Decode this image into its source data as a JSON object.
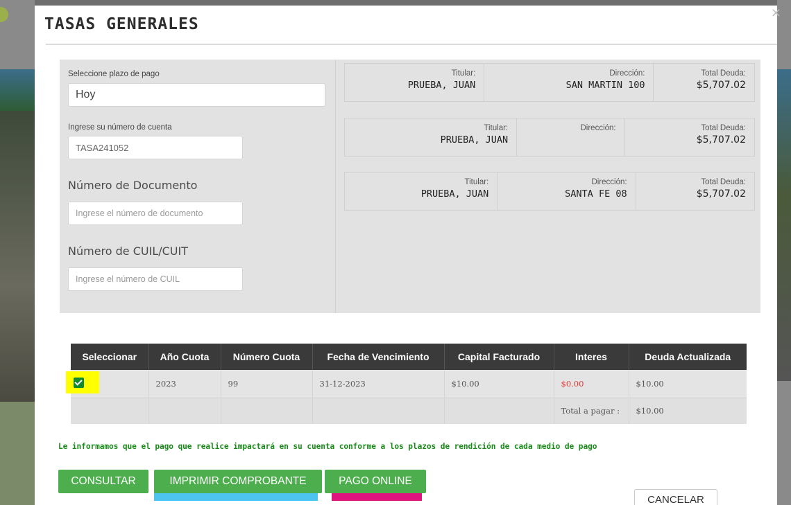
{
  "modal": {
    "title": "TASAS GENERALES",
    "close_glyph": "×"
  },
  "form": {
    "plazo_label": "Seleccione plazo de pago",
    "plazo_value": "Hoy",
    "cuenta_label": "Ingrese su número de cuenta",
    "cuenta_value": "TASA241052",
    "documento_label": "Número de Documento",
    "documento_placeholder": "Ingrese el número de documento",
    "cuil_label": "Número de CUIL/CUIT",
    "cuil_placeholder": "Ingrese el número de CUIL"
  },
  "cards": [
    {
      "titular_label": "Titular:",
      "titular": "PRUEBA, JUAN",
      "direccion_label": "Dirección:",
      "direccion": "SAN MARTIN 100",
      "deuda_label": "Total Deuda:",
      "deuda": "$5,707.02"
    },
    {
      "titular_label": "Titular:",
      "titular": "PRUEBA, JUAN",
      "direccion_label": "Dirección:",
      "direccion": "",
      "deuda_label": "Total Deuda:",
      "deuda": "$5,707.02"
    },
    {
      "titular_label": "Titular:",
      "titular": "PRUEBA, JUAN",
      "direccion_label": "Dirección:",
      "direccion": "SANTA FE 08",
      "deuda_label": "Total Deuda:",
      "deuda": "$5,707.02"
    }
  ],
  "table": {
    "headers": [
      "Seleccionar",
      "Año Cuota",
      "Número Cuota",
      "Fecha de Vencimiento",
      "Capital Facturado",
      "Interes",
      "Deuda Actualizada"
    ],
    "row": {
      "selected": true,
      "anio": "2023",
      "numero": "99",
      "vencimiento": "31-12-2023",
      "capital": "$10.00",
      "interes": "$0.00",
      "deuda": "$10.00"
    },
    "total_label": "Total a pagar :",
    "total_value": "$10.00"
  },
  "notice": "Le informamos que el pago que realice impactará en su cuenta conforme a los plazos de rendición de cada medio de pago",
  "buttons": {
    "consultar": "CONSULTAR",
    "imprimir": "IMPRIMIR COMPROBANTE",
    "pago_online": "PAGO ONLINE",
    "cancelar": "CANCELAR"
  },
  "colors": {
    "button_green": "#4cae4c",
    "notice_green": "#1b8a1b",
    "interes_red": "#e53935",
    "highlight_yellow": "#ffff00",
    "underline_blue": "#4dc3f0",
    "underline_pink": "#e0147f"
  }
}
